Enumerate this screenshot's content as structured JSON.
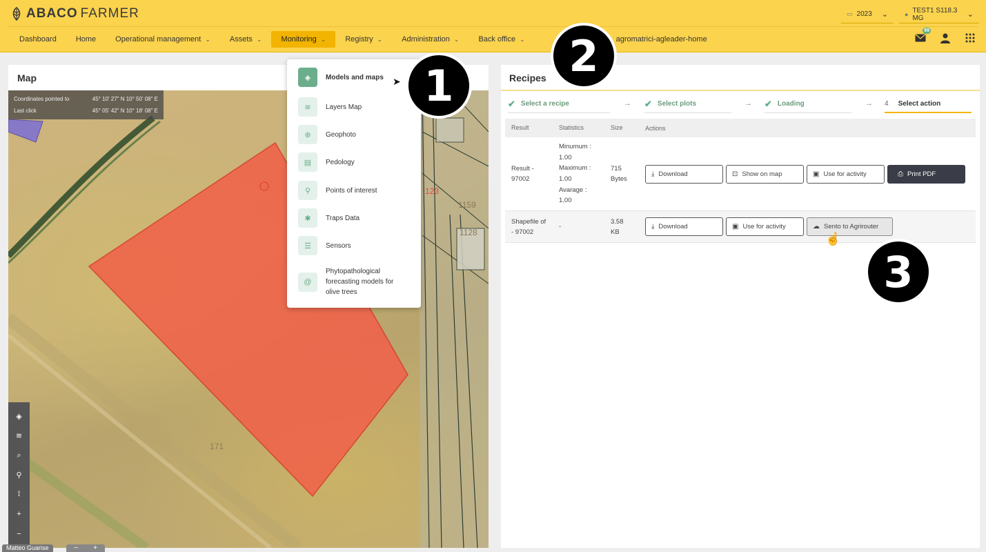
{
  "app": {
    "brand_bold": "ABACO",
    "brand_light": "FARMER"
  },
  "header": {
    "year": "2023",
    "farm": "TEST1 S118.3 MG",
    "notifications_badge": "99"
  },
  "nav": {
    "items": [
      {
        "label": "Dashboard",
        "dropdown": false
      },
      {
        "label": "Home",
        "dropdown": false
      },
      {
        "label": "Operational management",
        "dropdown": true
      },
      {
        "label": "Assets",
        "dropdown": true
      },
      {
        "label": "Monitoring",
        "dropdown": true,
        "active": true
      },
      {
        "label": "Registry",
        "dropdown": true
      },
      {
        "label": "Administration",
        "dropdown": true
      },
      {
        "label": "Back office",
        "dropdown": true
      },
      {
        "label": "agromatrici-agleader-home",
        "dropdown": false
      }
    ]
  },
  "map": {
    "title": "Map",
    "coords_pointed_label": "Coordinates pointed to",
    "coords_pointed_value": "45° 10' 27\" N 10° 50' 08\" E",
    "last_click_label": "Last click",
    "last_click_value": "45° 05' 42\" N 10° 18' 08\" E",
    "parcel_labels": [
      "171",
      "1159",
      "1128",
      "123"
    ],
    "bottom_tab": "Matteo Guarise",
    "zoom_minus": "−",
    "zoom_plus": "+"
  },
  "dropdown": {
    "items": [
      {
        "label": "Models and maps",
        "icon": "layers-diamond-icon",
        "active": true
      },
      {
        "label": "Layers Map",
        "icon": "layers-icon"
      },
      {
        "label": "Geophoto",
        "icon": "globe-icon"
      },
      {
        "label": "Pedology",
        "icon": "soil-file-icon"
      },
      {
        "label": "Points of interest",
        "icon": "pin-icon"
      },
      {
        "label": "Traps Data",
        "icon": "bug-icon"
      },
      {
        "label": "Sensors",
        "icon": "sliders-icon"
      },
      {
        "label": "Phytopathological forecasting models for olive trees",
        "icon": "at-icon"
      }
    ]
  },
  "recipes": {
    "title": "Recipes",
    "steps": [
      {
        "label": "Select a recipe",
        "done": true
      },
      {
        "label": "Select plots",
        "done": true
      },
      {
        "label": "Loading",
        "done": true
      },
      {
        "num": "4",
        "label": "Select action",
        "done": false
      }
    ],
    "headers": {
      "result": "Result",
      "statistics": "Statistics",
      "size": "Size",
      "actions": "Actions"
    },
    "rows": [
      {
        "result_line1": "Result -",
        "result_line2": "97002",
        "stats": [
          "Minumum :",
          "1.00",
          "Maximum :",
          "1.00",
          "Avarage :",
          "1.00"
        ],
        "size_line1": "715",
        "size_line2": "Bytes",
        "actions": [
          "Download",
          "Show on map",
          "Use for activity",
          "Print PDF"
        ]
      },
      {
        "result_line1": "Shapefile of",
        "result_line2": "- 97002",
        "stats": [
          "-"
        ],
        "size_line1": "3.58",
        "size_line2": "KB",
        "actions": [
          "Download",
          "Use for activity",
          "Sento to Agrirouter"
        ]
      }
    ]
  },
  "callouts": [
    "1",
    "2",
    "3"
  ],
  "colors": {
    "topbar": "#fbd34d",
    "nav_active": "#f2b400",
    "accent_green": "#6aae8b",
    "polygon_fill": "#f0624a"
  }
}
